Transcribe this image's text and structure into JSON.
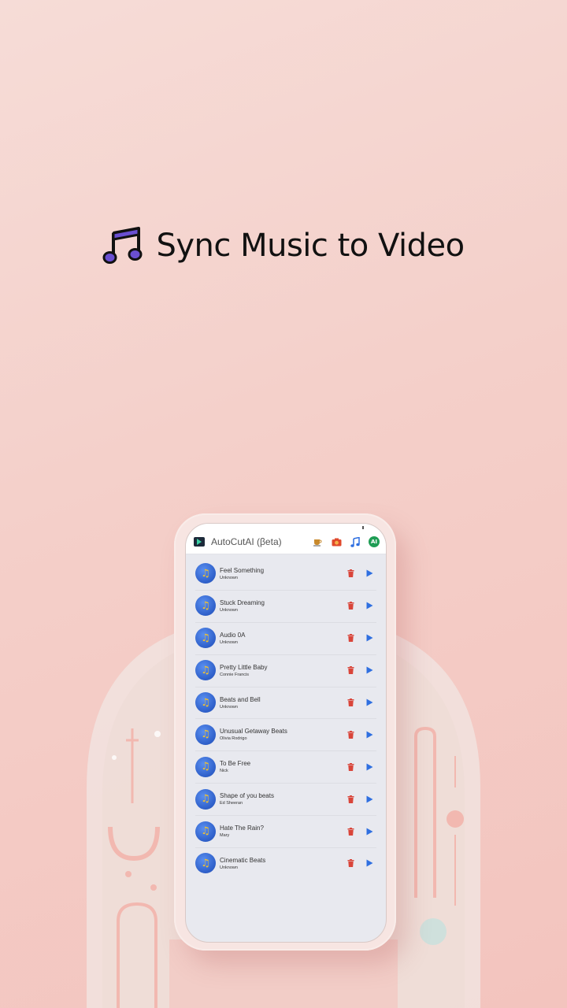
{
  "headline": {
    "title": "Sync Music to Video"
  },
  "app": {
    "title": "AutoCutAI (βeta)",
    "actions": [
      "coffee-icon",
      "camera-icon",
      "music-note-icon",
      "ai-icon"
    ],
    "ai_label": "AI"
  },
  "songs": [
    {
      "title": "Feel Something",
      "artist": "Unknown"
    },
    {
      "title": "Stuck Dreaming",
      "artist": "Unknown"
    },
    {
      "title": "Audio 0A",
      "artist": "Unknown"
    },
    {
      "title": "Pretty Little Baby",
      "artist": "Connie Francis"
    },
    {
      "title": "Beats and Bell",
      "artist": "Unknown"
    },
    {
      "title": "Unusual Getaway Beats",
      "artist": "Olivia Rodrigo"
    },
    {
      "title": "To Be Free",
      "artist": "Nick"
    },
    {
      "title": "Shape of you beats",
      "artist": "Ed Sheeran"
    },
    {
      "title": "Hate The Rain?",
      "artist": "Mary"
    },
    {
      "title": "Cinematic Beats",
      "artist": "Unknown"
    }
  ],
  "colors": {
    "accent_purple": "#6a4fd1",
    "trash": "#d9453a",
    "play": "#2f6fe0",
    "background": "#f4cfc9"
  }
}
